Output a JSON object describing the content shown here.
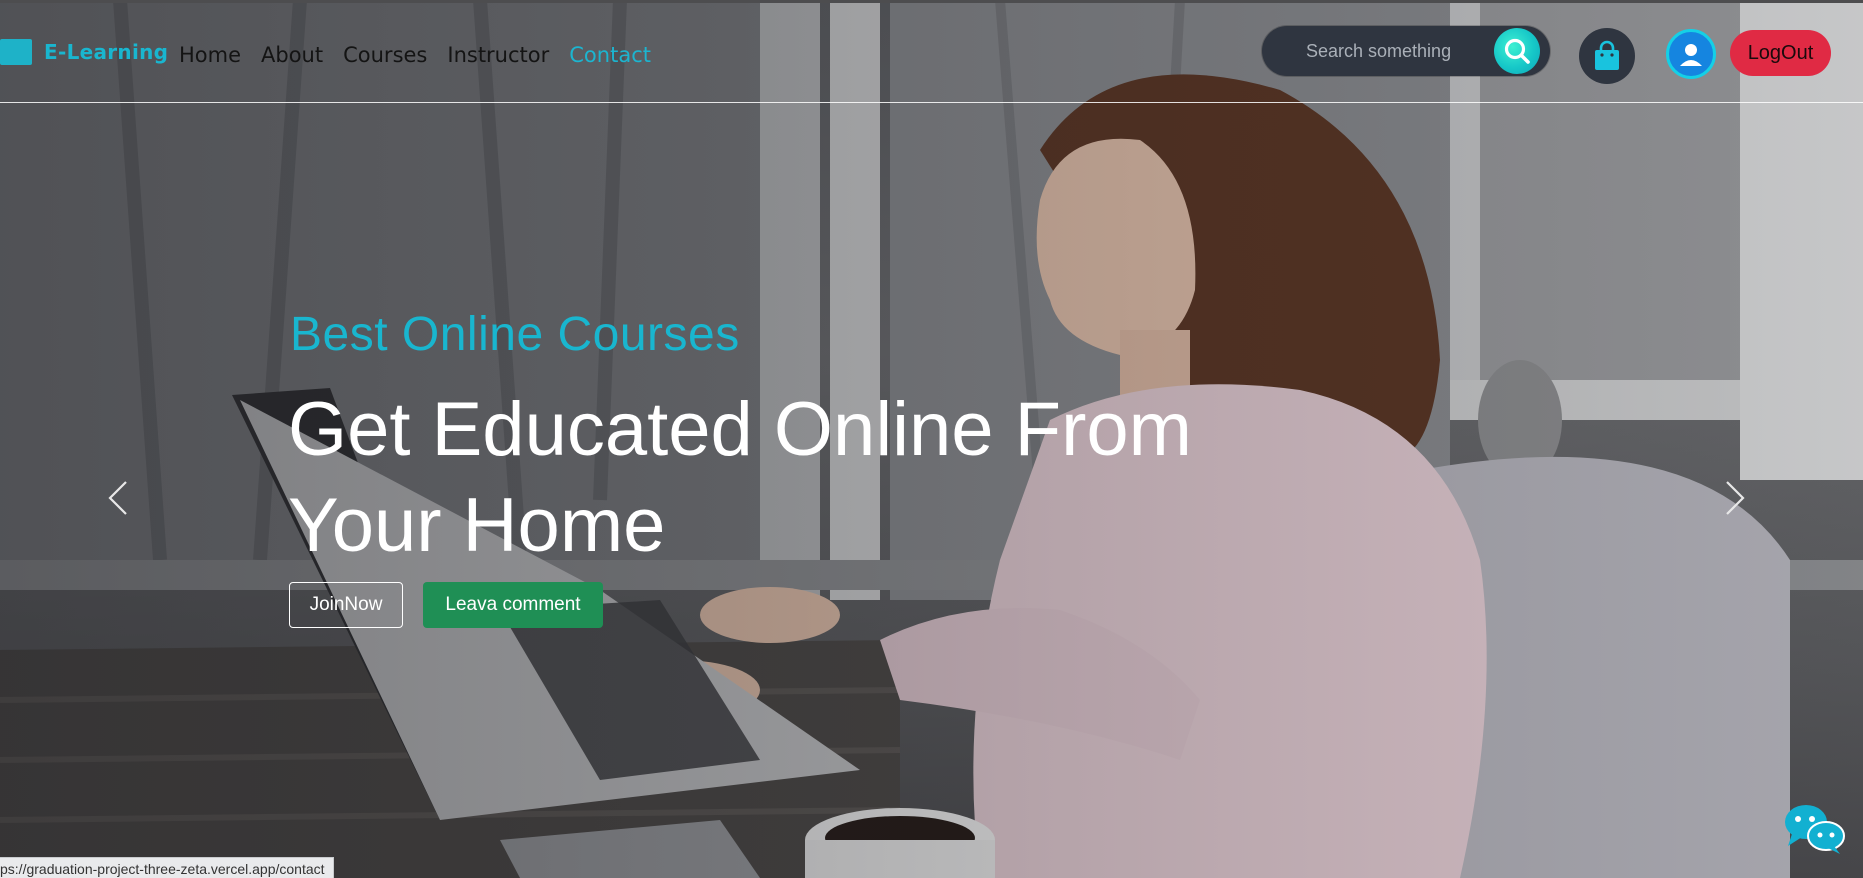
{
  "brand": {
    "name": "E-Learning",
    "color": "#1cb5d0"
  },
  "nav": {
    "links": [
      {
        "label": "Home",
        "active": false
      },
      {
        "label": "About",
        "active": false
      },
      {
        "label": "Courses",
        "active": false
      },
      {
        "label": "Instructor",
        "active": false
      },
      {
        "label": "Contact",
        "active": true
      }
    ]
  },
  "search": {
    "placeholder": "Search something",
    "value": "",
    "icon": "search-icon"
  },
  "header_actions": {
    "cart_icon": "shopping-bag-icon",
    "user_icon": "user-avatar-icon",
    "logout_label": "LogOut",
    "logout_color": "#e02a44"
  },
  "hero": {
    "eyebrow": "Best Online Courses",
    "headline_line1": "Get Educated Online From",
    "headline_line2": "Your Home",
    "primary_button": "JoinNow",
    "secondary_button": "Leava comment",
    "secondary_color": "#1f8f55",
    "prev_icon": "chevron-left-icon",
    "next_icon": "chevron-right-icon"
  },
  "chat": {
    "icon": "chat-bubbles-icon"
  },
  "status_bar": {
    "url": "ps://graduation-project-three-zeta.vercel.app/contact"
  }
}
